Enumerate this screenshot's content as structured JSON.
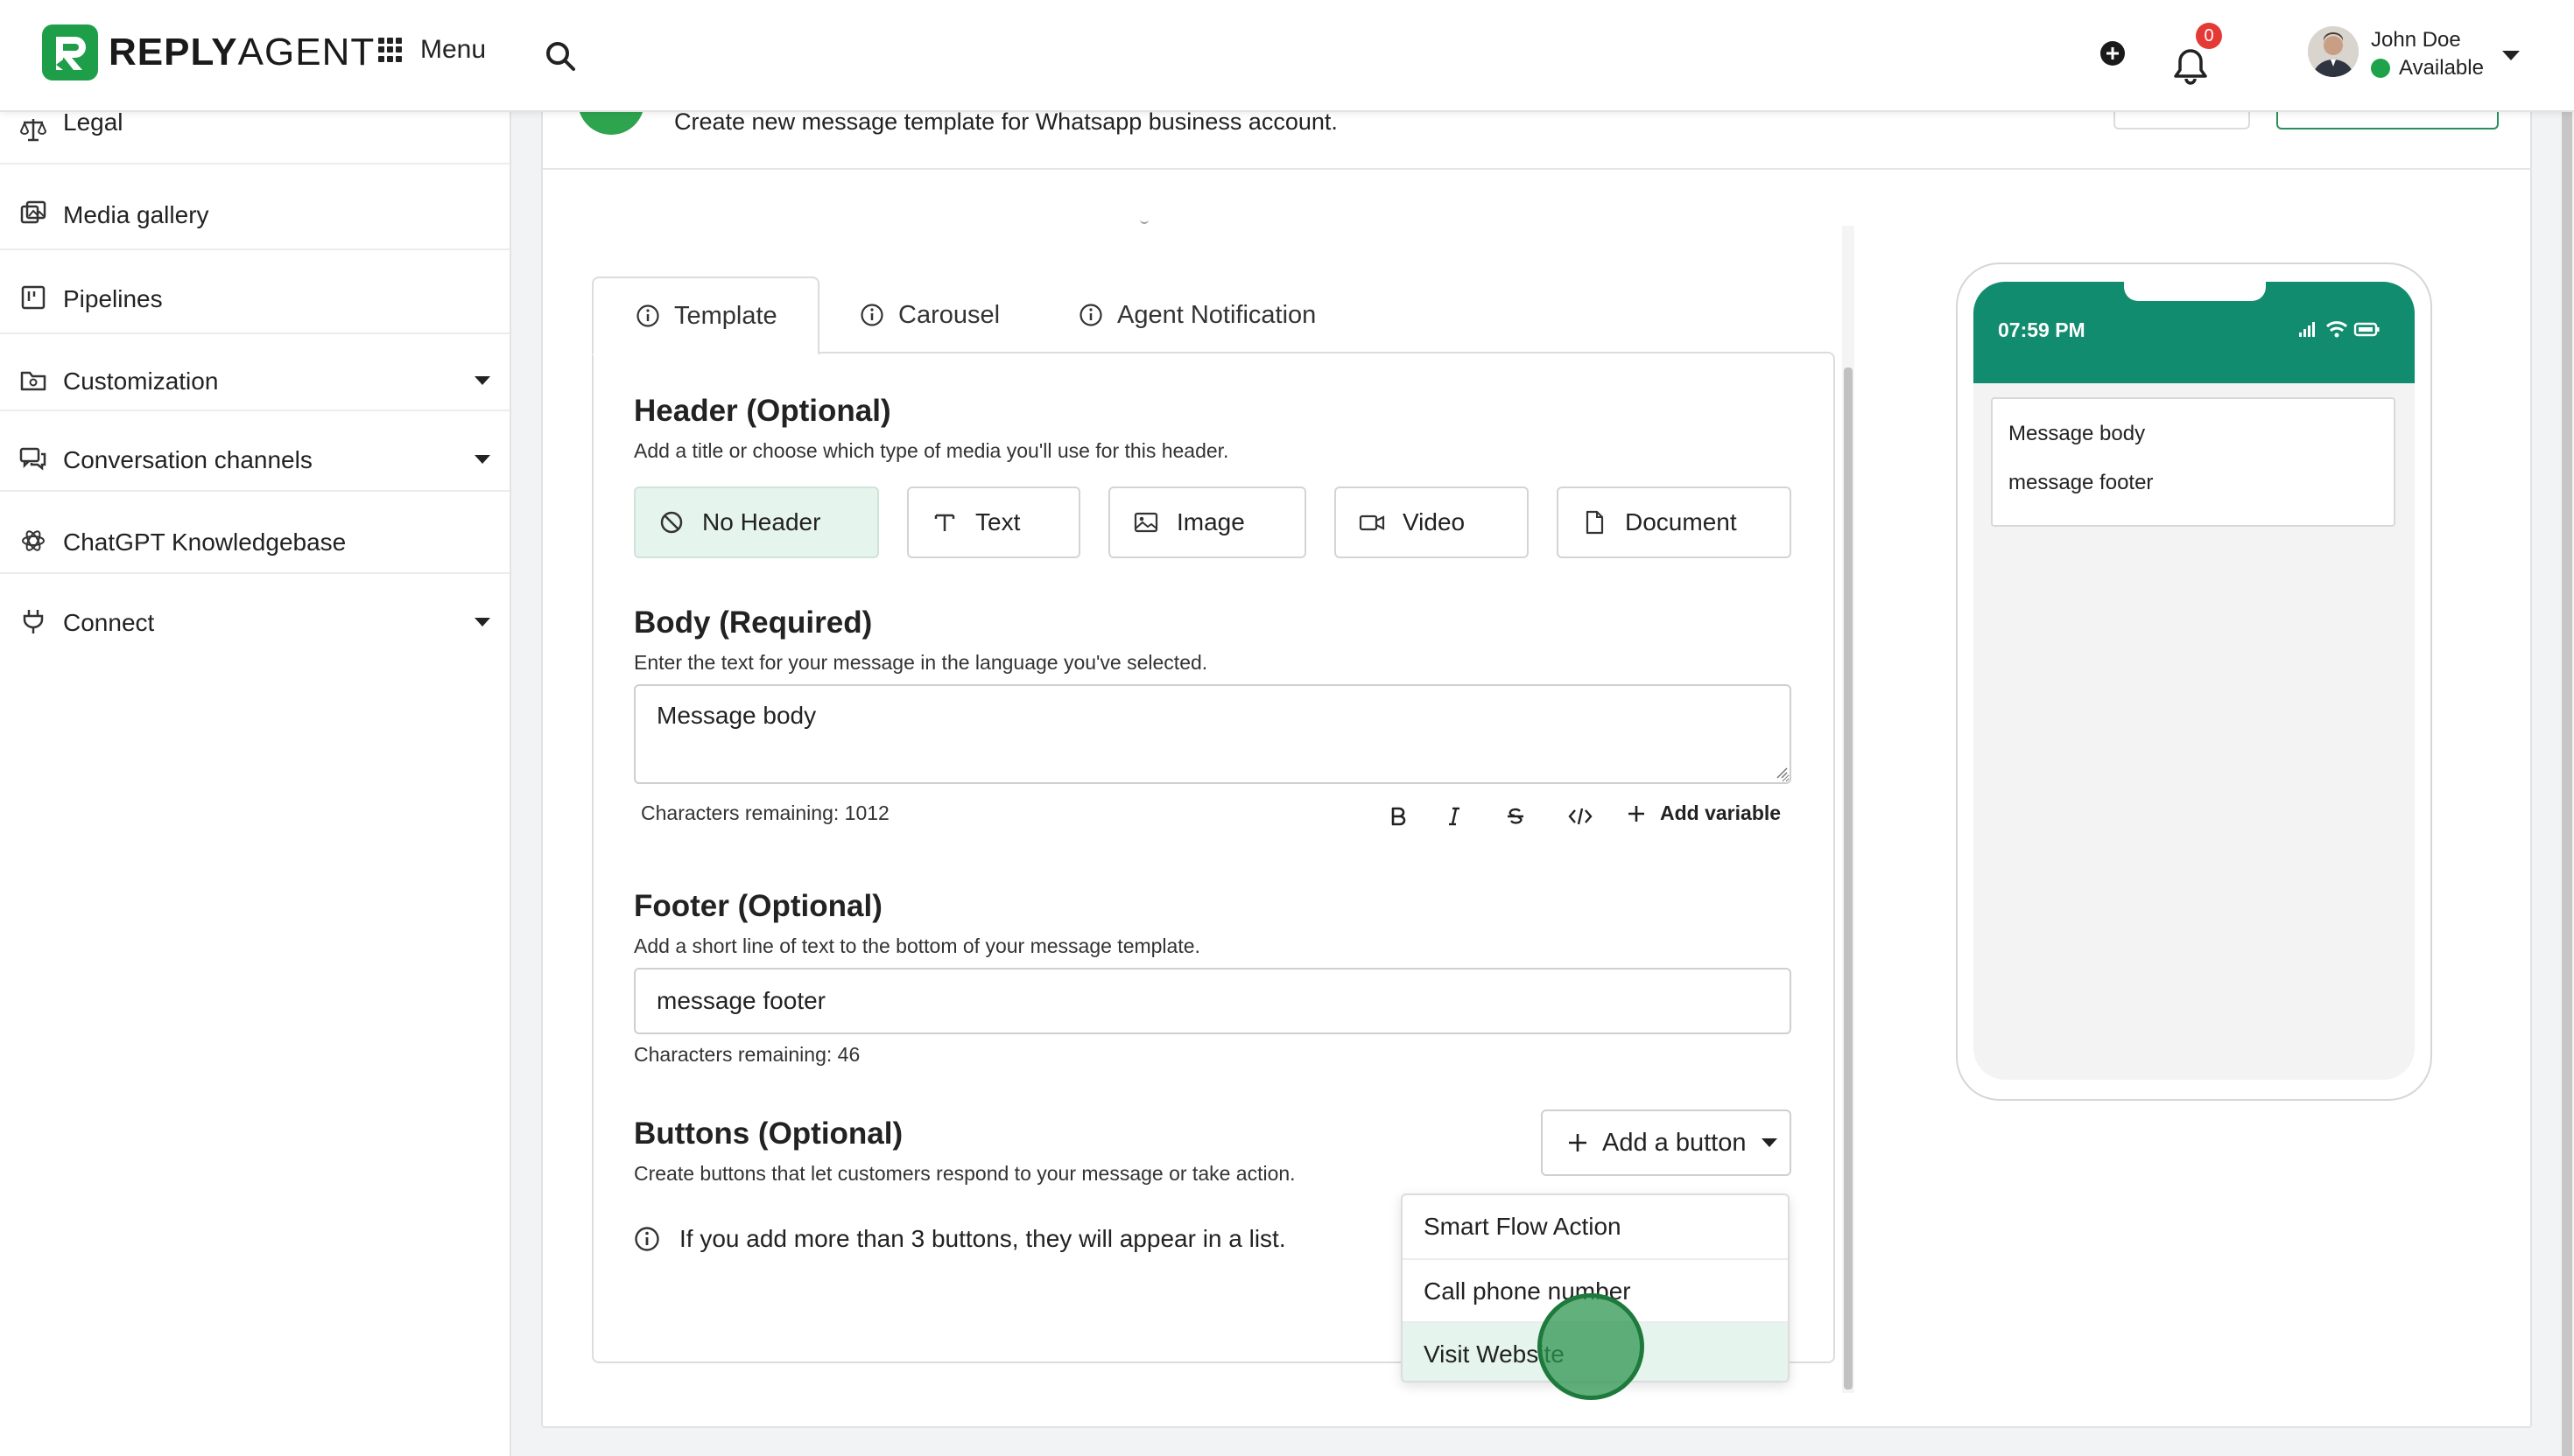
{
  "app": {
    "brand_bold": "REPLY",
    "brand_light": "AGENT"
  },
  "topbar": {
    "menu_label": "Menu",
    "notifications_count": "0",
    "user_name": "John Doe",
    "user_status": "Available"
  },
  "sidebar": {
    "items": [
      {
        "label": "Legal",
        "icon": "scale-icon",
        "has_caret": false
      },
      {
        "label": "Media gallery",
        "icon": "gallery-icon",
        "has_caret": false
      },
      {
        "label": "Pipelines",
        "icon": "pipeline-icon",
        "has_caret": false
      },
      {
        "label": "Customization",
        "icon": "customization-icon",
        "has_caret": true
      },
      {
        "label": "Conversation channels",
        "icon": "chat-icon",
        "has_caret": true
      },
      {
        "label": "ChatGPT Knowledgebase",
        "icon": "openai-icon",
        "has_caret": false
      },
      {
        "label": "Connect",
        "icon": "plug-icon",
        "has_caret": true
      }
    ]
  },
  "page": {
    "description": "Create new message template for Whatsapp business account."
  },
  "tabs": [
    {
      "label": "Template",
      "active": true
    },
    {
      "label": "Carousel",
      "active": false
    },
    {
      "label": "Agent Notification",
      "active": false
    }
  ],
  "header_section": {
    "title": "Header (Optional)",
    "description": "Add a title or choose which type of media you'll use for this header.",
    "options": [
      {
        "label": "No Header",
        "icon": "no-header-icon",
        "selected": true
      },
      {
        "label": "Text",
        "icon": "text-icon",
        "selected": false
      },
      {
        "label": "Image",
        "icon": "image-icon",
        "selected": false
      },
      {
        "label": "Video",
        "icon": "video-icon",
        "selected": false
      },
      {
        "label": "Document",
        "icon": "document-icon",
        "selected": false
      }
    ]
  },
  "body_section": {
    "title": "Body (Required)",
    "description": "Enter the text for your message in the language you've selected.",
    "value": "Message body",
    "counter": "Characters remaining: 1012",
    "add_variable_label": "Add variable"
  },
  "footer_section": {
    "title": "Footer (Optional)",
    "description": "Add a short line of text to the bottom of your message template.",
    "value": "message footer",
    "counter": "Characters remaining: 46"
  },
  "buttons_section": {
    "title": "Buttons (Optional)",
    "description": "Create buttons that let customers respond to your message or take action.",
    "add_button_label": "Add a button",
    "info": "If you add more than 3 buttons, they will appear in a list.",
    "dropdown": [
      {
        "label": "Smart Flow Action"
      },
      {
        "label": "Call phone number"
      },
      {
        "label": "Visit Website"
      }
    ]
  },
  "preview": {
    "time": "07:59 PM",
    "body": "Message body",
    "footer": "message footer",
    "header_color": "#128c6e"
  },
  "colors": {
    "accent": "#1fa34a",
    "selected_bg": "#e6f4ee",
    "badge": "#e53935"
  }
}
